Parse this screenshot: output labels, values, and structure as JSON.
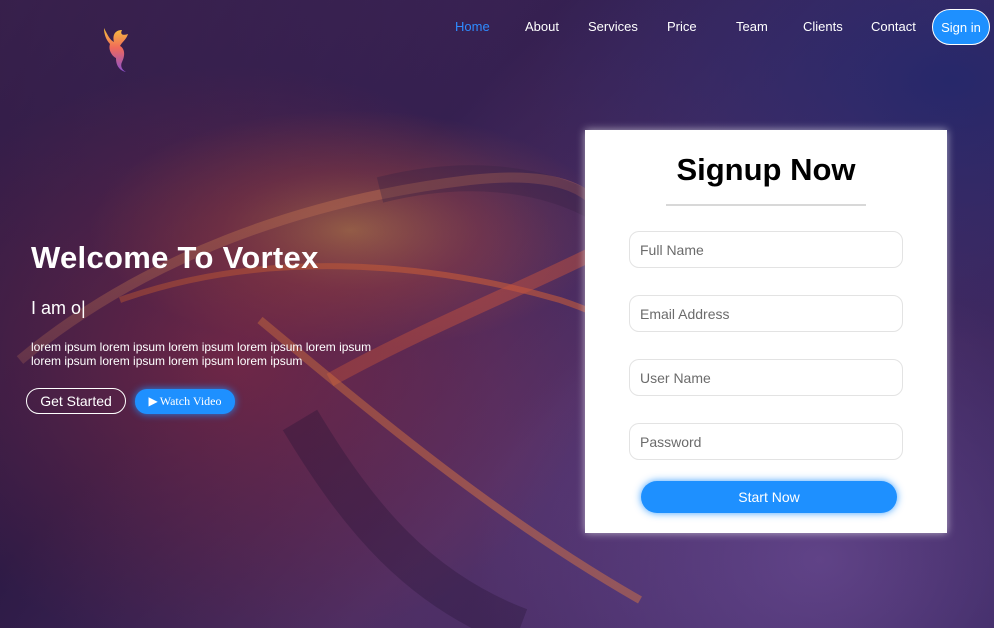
{
  "nav": {
    "items": [
      {
        "label": "Home",
        "active": true
      },
      {
        "label": "About"
      },
      {
        "label": "Services"
      },
      {
        "label": "Price"
      },
      {
        "label": "Team"
      },
      {
        "label": "Clients"
      },
      {
        "label": "Contact"
      }
    ],
    "signin_label": "Sign in"
  },
  "logo": {
    "icon": "phoenix-logo-icon"
  },
  "hero": {
    "title": "Welcome To Vortex",
    "typed_text": "I am o",
    "cursor": "|",
    "description": "lorem ipsum lorem ipsum lorem ipsum lorem ipsum lorem ipsum lorem ipsum lorem ipsum lorem ipsum lorem ipsum",
    "get_started_label": "Get Started",
    "watch_video_label": "Watch Video",
    "play_icon": "▶"
  },
  "signup": {
    "title": "Signup Now",
    "fields": [
      {
        "placeholder": "Full Name"
      },
      {
        "placeholder": "Email Address"
      },
      {
        "placeholder": "User Name"
      },
      {
        "placeholder": "Password"
      }
    ],
    "submit_label": "Start Now"
  },
  "colors": {
    "accent": "#1e90ff",
    "nav_active": "#2e8bff",
    "text_light": "#ffffff"
  }
}
